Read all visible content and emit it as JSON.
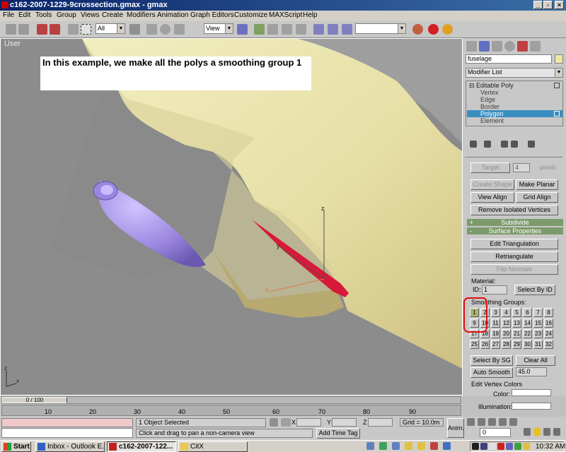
{
  "window": {
    "title": "c162-2007-1229-9crossection.gmax - gmax"
  },
  "menu": [
    "File",
    "Edit",
    "Tools",
    "Group",
    "Views",
    "Create",
    "Modifiers",
    "Animation",
    "Graph Editors",
    "Customize",
    "MAXScript",
    "Help"
  ],
  "toolbar": {
    "selection_filter": "All",
    "ref_coord": "View"
  },
  "viewport": {
    "label": "User",
    "annotation": "In this example, we make all the polys a smoothing group 1",
    "axis_z": "z",
    "axis_x": "x",
    "axis_y": "y"
  },
  "command_panel": {
    "object_name": "fuselage",
    "object_color": "#f0e6a8",
    "modifier_list": "Modifier List",
    "stack": {
      "root": "Editable Poly",
      "items": [
        "Vertex",
        "Edge",
        "Border",
        "Polygon",
        "Element"
      ],
      "selected": "Polygon"
    },
    "target_label": "Target",
    "target_value": "4",
    "pixels_label": "pixels",
    "create_shape": "Create Shape",
    "make_planar": "Make Planar",
    "view_align": "View Align",
    "grid_align": "Grid Align",
    "remove_isolated": "Remove Isolated Vertices",
    "subdivide": "Subdivide",
    "surface_properties": "Surface Properties",
    "edit_triangulation": "Edit Triangulation",
    "retriangulate": "Retriangulate",
    "flip_normals": "Flip Normals",
    "material_label": "Material:",
    "id_label": "ID:",
    "id_value": "1",
    "select_by_id": "Select By ID",
    "smoothing_groups_label": "Smoothing Groups:",
    "smoothing_groups": [
      "1",
      "2",
      "3",
      "4",
      "5",
      "6",
      "7",
      "8",
      "9",
      "10",
      "11",
      "12",
      "13",
      "14",
      "15",
      "16",
      "17",
      "18",
      "19",
      "20",
      "21",
      "22",
      "23",
      "24",
      "25",
      "26",
      "27",
      "28",
      "29",
      "30",
      "31",
      "32"
    ],
    "active_group": "1",
    "select_by_sg": "Select By SG",
    "clear_all": "Clear All",
    "auto_smooth": "Auto Smooth",
    "auto_smooth_value": "45.0",
    "edit_vertex_colors": "Edit Vertex Colors",
    "color_label": "Color:",
    "illumination_label": "Illumination:"
  },
  "timeline": {
    "frame": "0 / 100",
    "ticks": [
      "10",
      "20",
      "30",
      "40",
      "50",
      "60",
      "70",
      "80",
      "90"
    ]
  },
  "status": {
    "selected": "1 Object Selected",
    "prompt": "Click and drag to pan a non-camera view",
    "x_label": "X",
    "y_label": "Y",
    "z_label": "Z",
    "grid": "Grid = 10.0m",
    "add_time_tag": "Add Time Tag",
    "anim": "Anim.",
    "frame_field": "0"
  },
  "taskbar": {
    "start": "Start",
    "buttons": [
      "Inbox - Outlook E...",
      "c162-2007-122...",
      "CitX"
    ],
    "active": "c162-2007-122...",
    "time": "10:32 AM"
  }
}
